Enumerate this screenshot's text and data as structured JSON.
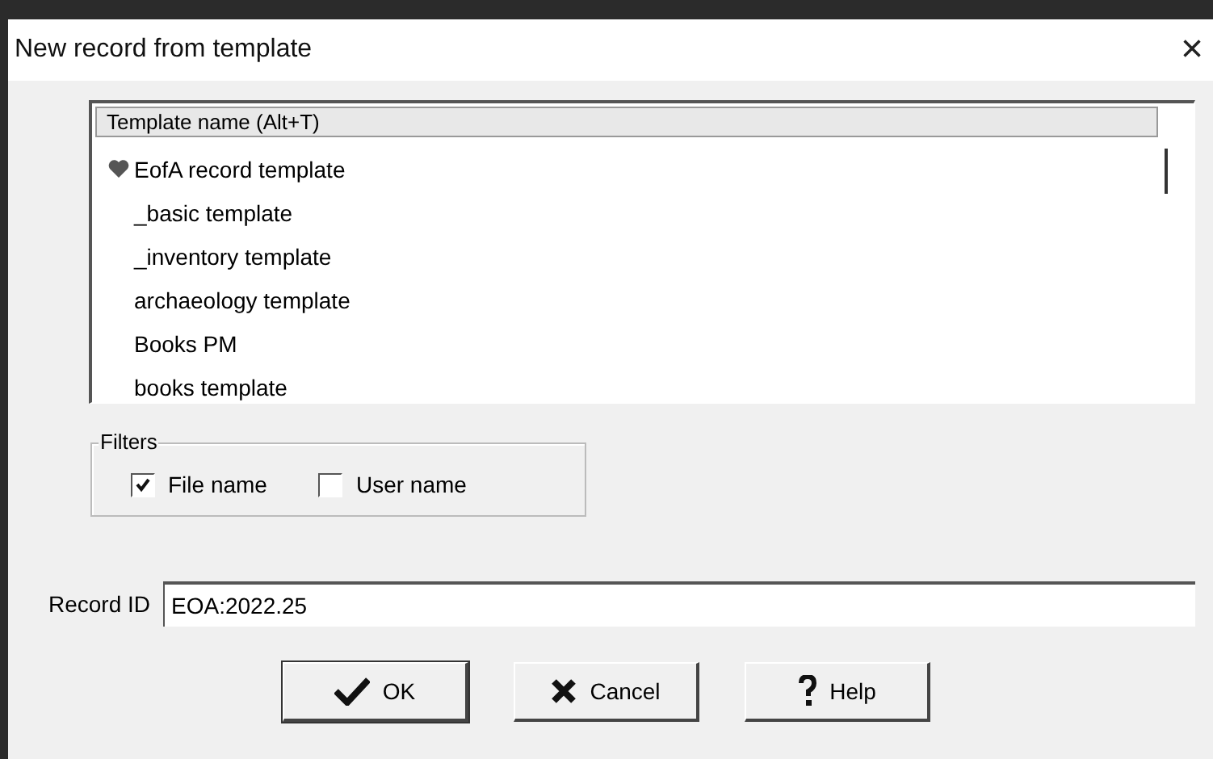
{
  "window": {
    "title": "New record from template",
    "close": "×"
  },
  "template_list": {
    "header": "Template name (Alt+T)",
    "items": [
      {
        "label": "EofA record template",
        "kind": "favorite"
      },
      {
        "label": "_basic template",
        "kind": "plain"
      },
      {
        "label": "_inventory template",
        "kind": "plain"
      },
      {
        "label": "archaeology template",
        "kind": "plain"
      },
      {
        "label": "Books PM",
        "kind": "plain"
      },
      {
        "label": "books template",
        "kind": "plain"
      }
    ]
  },
  "filters": {
    "title": "Filters",
    "options": [
      {
        "label": "File name",
        "checked": true
      },
      {
        "label": "User name",
        "checked": false
      }
    ]
  },
  "record_id": {
    "label": "Record ID",
    "value": "EOA:2022.25"
  },
  "buttons": [
    {
      "label": "OK",
      "kind": "ok"
    },
    {
      "label": "Cancel",
      "kind": "cancel"
    },
    {
      "label": "Help",
      "kind": "help"
    }
  ]
}
